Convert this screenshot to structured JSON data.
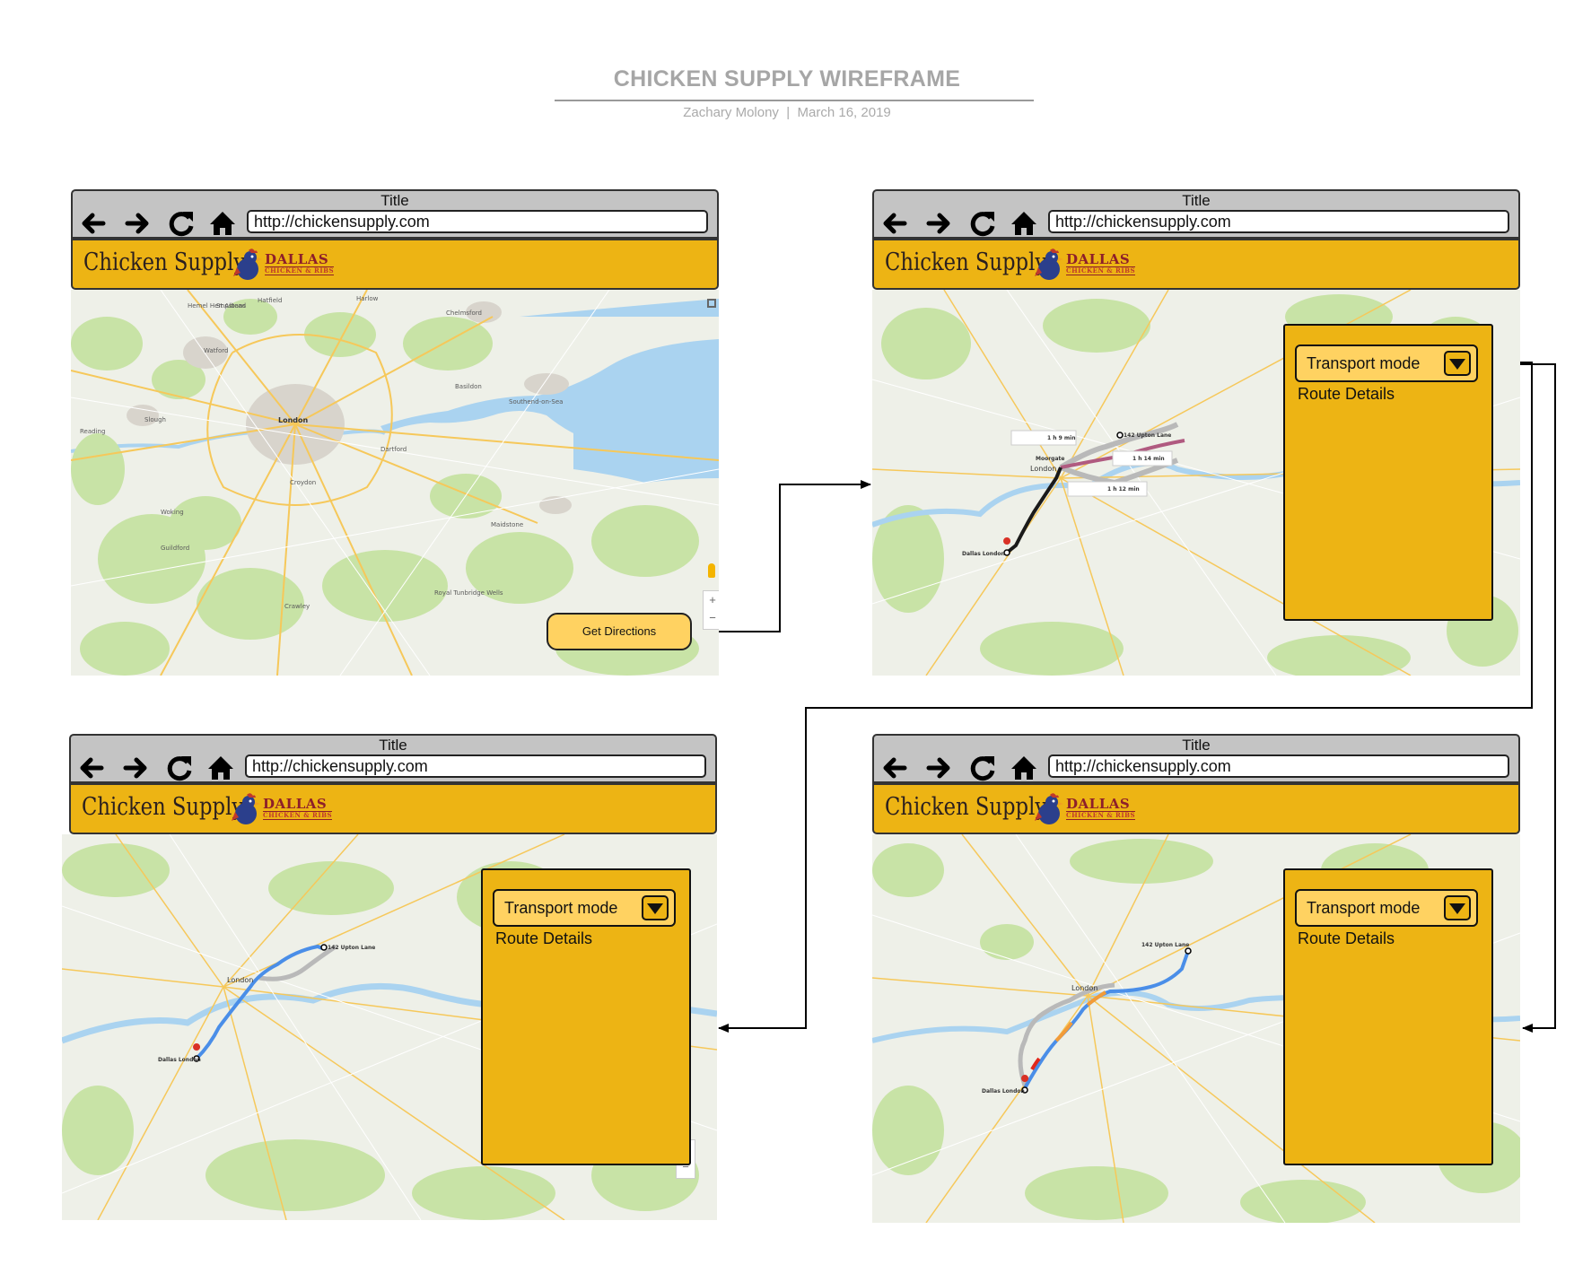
{
  "header": {
    "title": "CHICKEN SUPPLY WIREFRAME",
    "author": "Zachary Molony",
    "separator": "|",
    "date": "March 16, 2019"
  },
  "browser": {
    "title": "Title",
    "url": "http://chickensupply.com",
    "icons": [
      "back-arrow-icon",
      "forward-arrow-icon",
      "refresh-icon",
      "home-icon"
    ]
  },
  "brand": {
    "name": "Chicken Supply",
    "logo_line1": "DALLAS",
    "logo_line2": "CHICKEN & RIBS"
  },
  "screens": [
    {
      "id": "map-overview",
      "button": "Get Directions"
    },
    {
      "id": "directions-transit",
      "transport_mode": "Transport mode",
      "route_details": "Route Details",
      "route_labels": {
        "origin": "Dallas London",
        "destination": "142 Upton Lane",
        "via": "Moorgate",
        "city": "London",
        "times": [
          "1 h 9 min",
          "1 h 14 min",
          "1 h 12 min"
        ]
      }
    },
    {
      "id": "directions-walk",
      "transport_mode": "Transport mode",
      "route_details": "Route Details",
      "route_labels": {
        "origin": "Dallas London",
        "destination": "142 Upton Lane",
        "city": "London"
      }
    },
    {
      "id": "directions-drive",
      "transport_mode": "Transport mode",
      "route_details": "Route Details",
      "route_labels": {
        "origin": "Dallas London",
        "destination": "142 Upton Lane",
        "city": "London"
      }
    }
  ],
  "map_place_labels": [
    "Harlow",
    "Chelmsford",
    "Hatfield",
    "St Albans",
    "Watford",
    "Slough",
    "London",
    "Dartford",
    "Southend-on-Sea",
    "Croydon",
    "Maidstone",
    "Guildford",
    "Crawley",
    "Royal Tunbridge Wells",
    "Hemel Hempstead",
    "Basildon",
    "Woking",
    "Reading"
  ],
  "colors": {
    "header_yellow": "#edb414",
    "button_yellow": "#ffd261",
    "chrome_gray": "#c4c4c4",
    "map_land": "#eef0e8",
    "map_green": "#c8e3a6",
    "map_water": "#aad3f0",
    "route_transit": "#1a1a1a",
    "route_blue": "#4a8ee8"
  }
}
